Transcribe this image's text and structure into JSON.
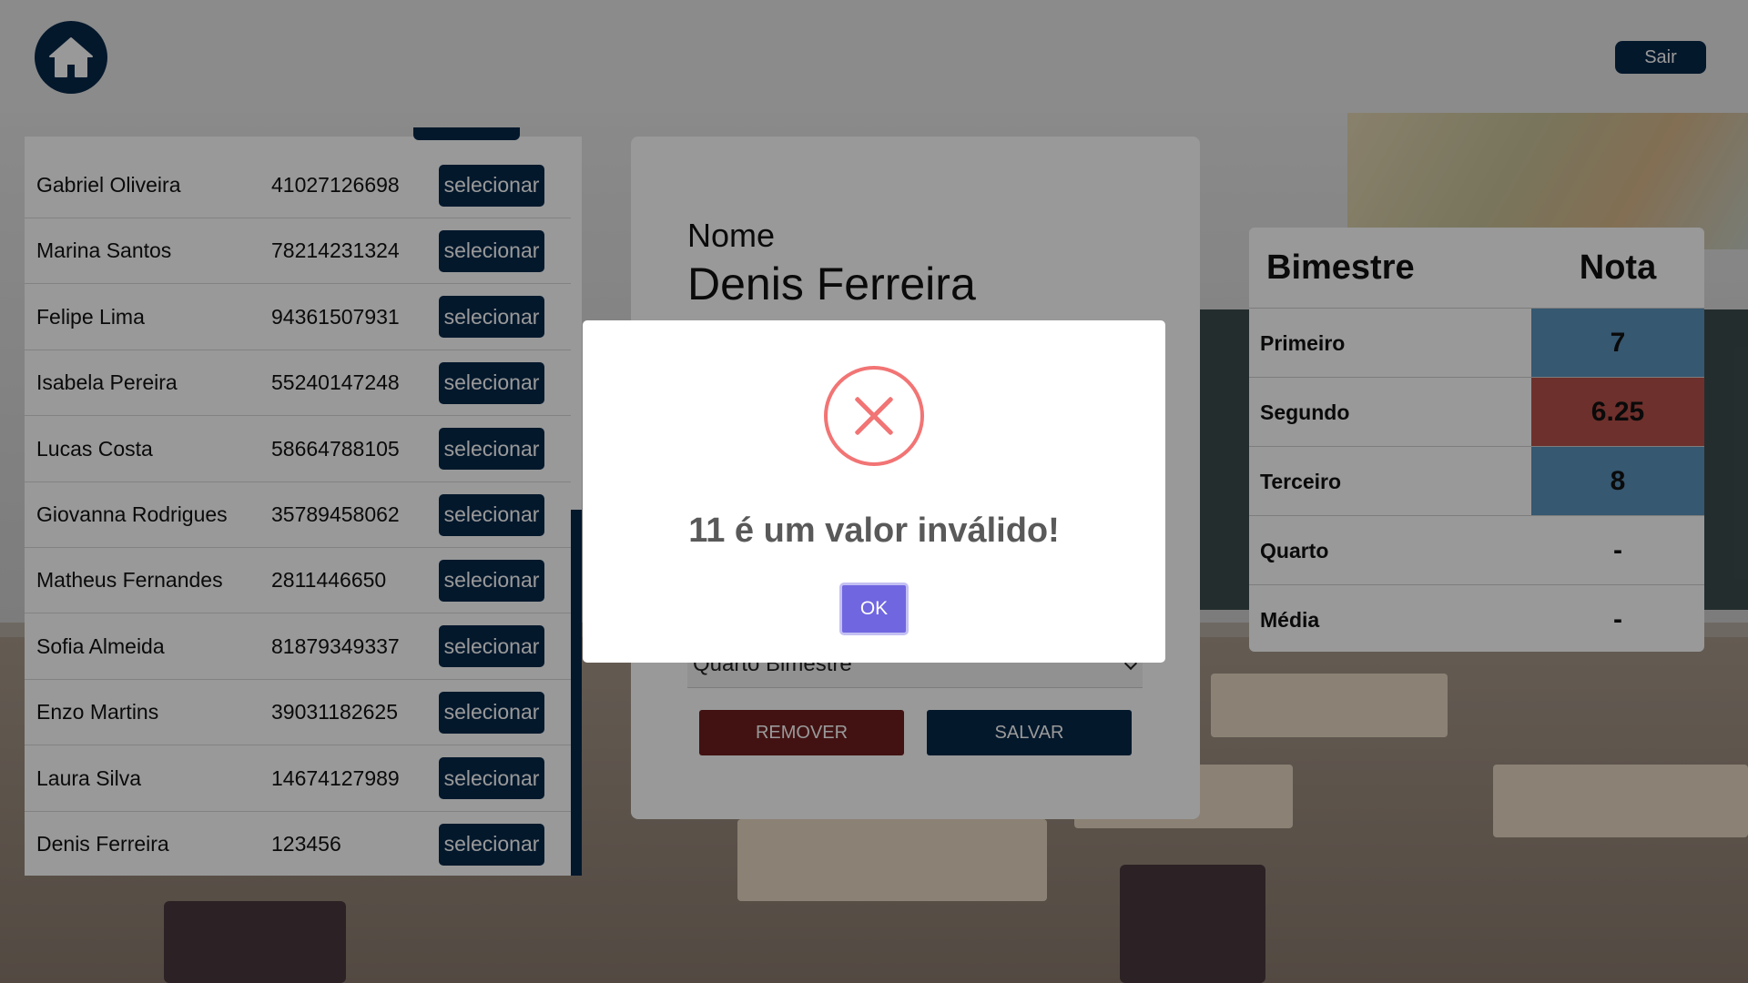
{
  "header": {
    "home_icon": "home-icon",
    "logout_label": "Sair"
  },
  "students": [
    {
      "name": "Gabriel Oliveira",
      "cpf": "41027126698",
      "action": "selecionar"
    },
    {
      "name": "Marina Santos",
      "cpf": "78214231324",
      "action": "selecionar"
    },
    {
      "name": "Felipe Lima",
      "cpf": "94361507931",
      "action": "selecionar"
    },
    {
      "name": "Isabela Pereira",
      "cpf": "55240147248",
      "action": "selecionar"
    },
    {
      "name": "Lucas Costa",
      "cpf": "58664788105",
      "action": "selecionar"
    },
    {
      "name": "Giovanna Rodrigues",
      "cpf": "35789458062",
      "action": "selecionar"
    },
    {
      "name": "Matheus Fernandes",
      "cpf": "2811446650",
      "action": "selecionar"
    },
    {
      "name": "Sofia Almeida",
      "cpf": "81879349337",
      "action": "selecionar"
    },
    {
      "name": "Enzo Martins",
      "cpf": "39031182625",
      "action": "selecionar"
    },
    {
      "name": "Laura Silva",
      "cpf": "14674127989",
      "action": "selecionar"
    },
    {
      "name": "Denis Ferreira",
      "cpf": "123456",
      "action": "selecionar"
    }
  ],
  "form": {
    "nome_label": "Nome",
    "nome_value": "Denis Ferreira",
    "bimestre_select": "Quarto Bimestre",
    "remove_label": "REMOVER",
    "save_label": "SALVAR"
  },
  "grades": {
    "col_bimestre": "Bimestre",
    "col_nota": "Nota",
    "rows": [
      {
        "label": "Primeiro",
        "value": "7",
        "color": "#5b93bd"
      },
      {
        "label": "Segundo",
        "value": "6.25",
        "color": "#b8514a"
      },
      {
        "label": "Terceiro",
        "value": "8",
        "color": "#5b93bd"
      },
      {
        "label": "Quarto",
        "value": "-",
        "color": ""
      },
      {
        "label": "Média",
        "value": "-",
        "color": ""
      }
    ]
  },
  "modal": {
    "icon": "error-x-icon",
    "message": "11 é um valor inválido!",
    "ok_label": "OK"
  },
  "colors": {
    "primary": "#08294a",
    "danger": "#6e1f1f",
    "modal_button": "#7066e0",
    "error": "#f27474"
  }
}
